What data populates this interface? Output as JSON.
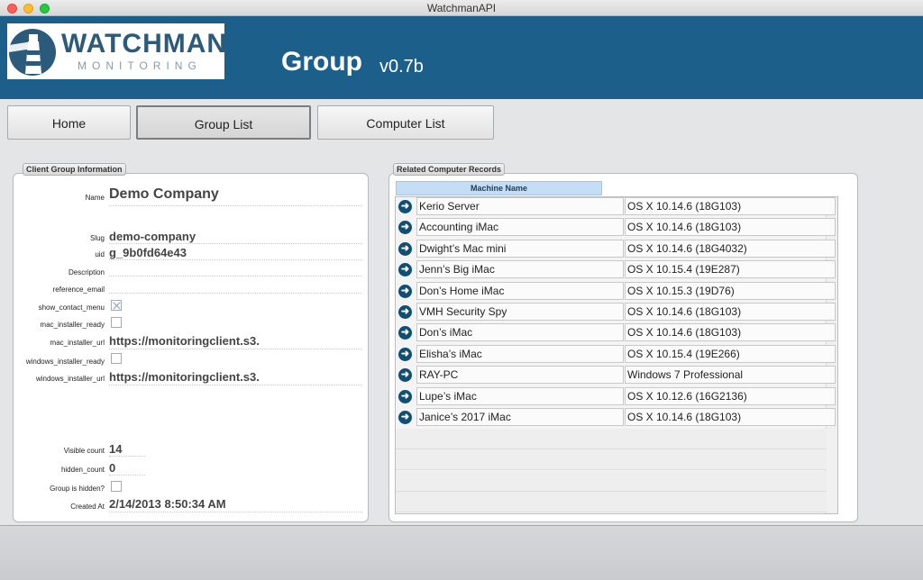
{
  "window": {
    "title": "WatchmanAPI"
  },
  "logo": {
    "name": "WATCHMAN",
    "sub": "MONITORING"
  },
  "header": {
    "title": "Group",
    "version": "v0.7b"
  },
  "nav": {
    "home": "Home",
    "group_list": "Group List",
    "computer_list": "Computer List"
  },
  "client_panel": {
    "label": "Client Group Information",
    "name_label": "Name",
    "name": "Demo Company",
    "slug_label": "Slug",
    "slug": "demo-company",
    "uid_label": "uid",
    "uid": "g_9b0fd64e43",
    "description_label": "Description",
    "description": "",
    "reference_email_label": "reference_email",
    "reference_email": "",
    "show_contact_menu_label": "show_contact_menu",
    "show_contact_menu": true,
    "mac_installer_ready_label": "mac_installer_ready",
    "mac_installer_ready": false,
    "mac_installer_url_label": "mac_installer_url",
    "mac_installer_url": "https://monitoringclient.s3.",
    "windows_installer_ready_label": "windows_installer_ready",
    "windows_installer_ready": false,
    "windows_installer_url_label": "windows_installer_url",
    "windows_installer_url": "https://monitoringclient.s3.",
    "visible_count_label": "Visible count",
    "visible_count": "14",
    "hidden_count_label": "hidden_count",
    "hidden_count": "0",
    "group_hidden_label": "Group is hidden?",
    "group_hidden": false,
    "created_at_label": "Created At",
    "created_at": "2/14/2013 8:50:34 AM"
  },
  "records_panel": {
    "label": "Related Computer Records",
    "column_header": "Machine Name",
    "records": [
      {
        "name": "Kerio Server",
        "os": "OS X 10.14.6 (18G103)"
      },
      {
        "name": "Accounting iMac",
        "os": "OS X 10.14.6 (18G103)"
      },
      {
        "name": "Dwight’s Mac mini",
        "os": "OS X 10.14.6 (18G4032)"
      },
      {
        "name": "Jenn’s Big iMac",
        "os": "OS X 10.15.4 (19E287)"
      },
      {
        "name": "Don’s Home iMac",
        "os": "OS X 10.15.3 (19D76)"
      },
      {
        "name": "VMH Security Spy",
        "os": "OS X 10.14.6 (18G103)"
      },
      {
        "name": "Don’s iMac",
        "os": "OS X 10.14.6 (18G103)"
      },
      {
        "name": "Elisha’s iMac",
        "os": "OS X 10.15.4 (19E266)"
      },
      {
        "name": "RAY-PC",
        "os": "Windows 7 Professional"
      },
      {
        "name": "Lupe’s iMac",
        "os": "OS X 10.12.6 (16G2136)"
      },
      {
        "name": "Janice’s 2017 iMac",
        "os": "OS X 10.14.6 (18G103)"
      }
    ]
  },
  "icons": {
    "row_arrow": "arrow-right-circle-icon"
  }
}
